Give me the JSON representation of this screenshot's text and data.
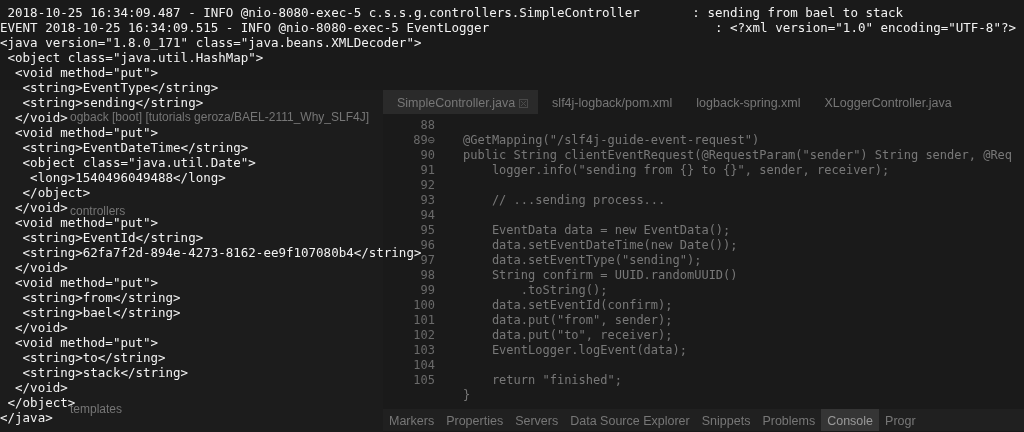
{
  "project_tree": {
    "items": [
      {
        "label": "ogback [boot] [tutorials geroza/BAEL-2111_Why_SLF4J]"
      },
      {
        "label": "controllers"
      },
      {
        "label": "templates"
      }
    ]
  },
  "editor": {
    "tabs": [
      {
        "label": "SimpleController.java",
        "selected": true
      },
      {
        "label": "slf4j-logback/pom.xml",
        "selected": false
      },
      {
        "label": "logback-spring.xml",
        "selected": false
      },
      {
        "label": "XLoggerController.java",
        "selected": false
      }
    ],
    "lines": [
      {
        "number": "88"
      },
      {
        "number": "89⊖",
        "code": "@GetMapping(\"/slf4j-guide-event-request\")"
      },
      {
        "number": "90",
        "code": "public String clientEventRequest(@RequestParam(\"sender\") String sender, @Req"
      },
      {
        "number": "91",
        "code": "    logger.info(\"sending from {} to {}\", sender, receiver);"
      },
      {
        "number": "92"
      },
      {
        "number": "93",
        "code": "    // ...sending process..."
      },
      {
        "number": "94"
      },
      {
        "number": "95",
        "code": "    EventData data = new EventData();"
      },
      {
        "number": "96",
        "code": "    data.setEventDateTime(new Date());"
      },
      {
        "number": "97",
        "code": "    data.setEventType(\"sending\");"
      },
      {
        "number": "98",
        "code": "    String confirm = UUID.randomUUID()"
      },
      {
        "number": "99",
        "code": "        .toString();"
      },
      {
        "number": "100",
        "code": "    data.setEventId(confirm);"
      },
      {
        "number": "101",
        "code": "    data.put(\"from\", sender);"
      },
      {
        "number": "102",
        "code": "    data.put(\"to\", receiver);"
      },
      {
        "number": "103",
        "code": "    EventLogger.logEvent(data);"
      },
      {
        "number": "104"
      },
      {
        "number": "105",
        "code": "    return \"finished\";"
      },
      {
        "code": "}"
      }
    ]
  },
  "views": {
    "tabs": [
      {
        "label": "Markers",
        "selected": false
      },
      {
        "label": "Properties",
        "selected": false
      },
      {
        "label": "Servers",
        "selected": false
      },
      {
        "label": "Data Source Explorer",
        "selected": false
      },
      {
        "label": "Snippets",
        "selected": false
      },
      {
        "label": "Problems",
        "selected": false
      },
      {
        "label": "Console",
        "selected": true
      },
      {
        "label": "Progr",
        "selected": false
      }
    ]
  },
  "terminal": {
    "lines": [
      " 2018-10-25 16:34:09.487 - INFO @nio-8080-exec-5 c.s.s.g.controllers.SimpleController       : sending from bael to stack",
      "EVENT 2018-10-25 16:34:09.515 - INFO @nio-8080-exec-5 EventLogger                              : <?xml version=\"1.0\" encoding=\"UTF-8\"?>",
      "<java version=\"1.8.0_171\" class=\"java.beans.XMLDecoder\">",
      " <object class=\"java.util.HashMap\">",
      "  <void method=\"put\">",
      "   <string>EventType</string>",
      "   <string>sending</string>",
      "  </void>",
      "  <void method=\"put\">",
      "   <string>EventDateTime</string>",
      "   <object class=\"java.util.Date\">",
      "    <long>1540496049488</long>",
      "   </object>",
      "  </void>",
      "  <void method=\"put\">",
      "   <string>EventId</string>",
      "   <string>62fa7f2d-894e-4273-8162-ee9f107080b4</string>",
      "  </void>",
      "  <void method=\"put\">",
      "   <string>from</string>",
      "   <string>bael</string>",
      "  </void>",
      "  <void method=\"put\">",
      "   <string>to</string>",
      "   <string>stack</string>",
      "  </void>",
      " </object>",
      "</java>"
    ]
  }
}
